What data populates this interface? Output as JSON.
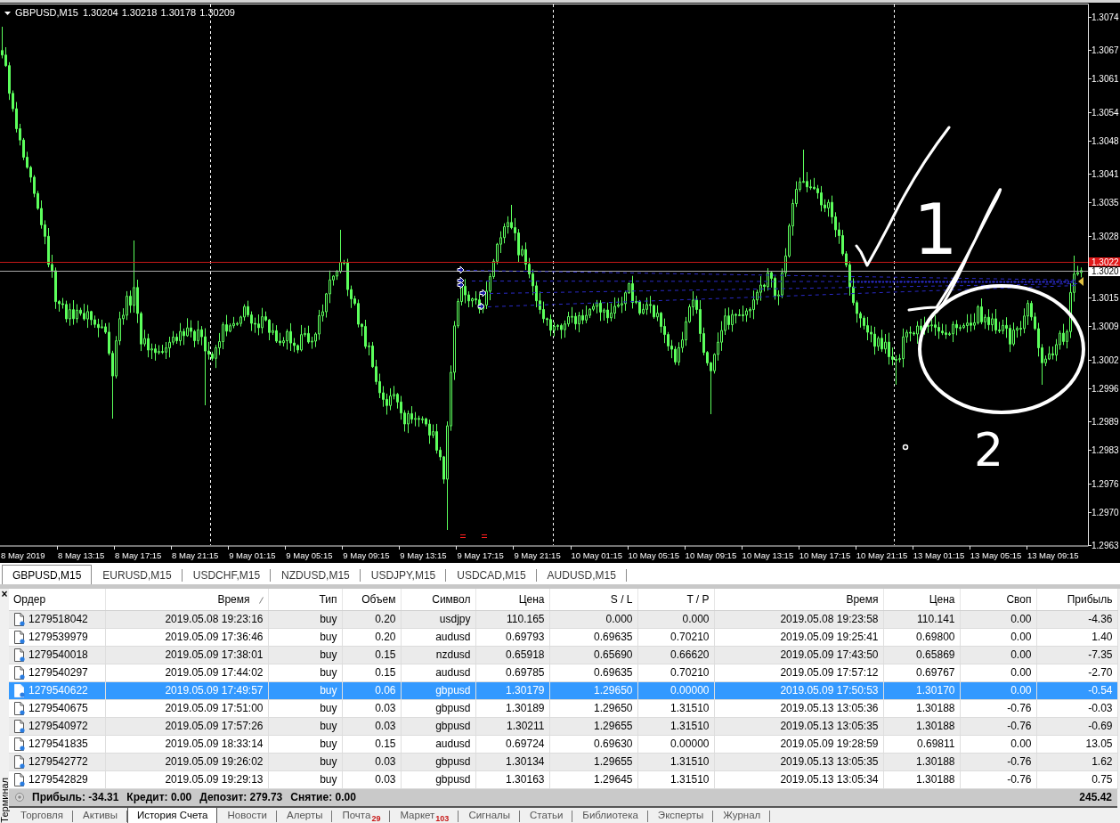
{
  "chart": {
    "symbol": "GBPUSD,M15",
    "quotes": [
      "1.30204",
      "1.30218",
      "1.30178",
      "1.30209"
    ],
    "price_labels": [
      "1.3074",
      "1.3067",
      "1.3061",
      "1.3054",
      "1.3048",
      "1.3041",
      "1.3035",
      "1.3028",
      "1.3015",
      "1.3009",
      "1.3002",
      "1.2996",
      "1.2989",
      "1.2983",
      "1.2976",
      "1.2970",
      "1.2963"
    ],
    "ask_label": "1.3022",
    "bid_label": "1.3020",
    "time_labels": [
      "8 May 2019",
      "8 May 13:15",
      "8 May 17:15",
      "8 May 21:15",
      "9 May 01:15",
      "9 May 05:15",
      "9 May 09:15",
      "9 May 13:15",
      "9 May 17:15",
      "9 May 21:15",
      "10 May 01:15",
      "10 May 05:15",
      "10 May 09:15",
      "10 May 13:15",
      "10 May 17:15",
      "10 May 21:15",
      "13 May 01:15",
      "13 May 05:15",
      "13 May 09:15"
    ],
    "annotations": [
      "1",
      "2"
    ]
  },
  "chart_tabs": [
    {
      "label": "GBPUSD,M15",
      "selected": true
    },
    {
      "label": "EURUSD,M15",
      "selected": false
    },
    {
      "label": "USDCHF,M15",
      "selected": false
    },
    {
      "label": "NZDUSD,M15",
      "selected": false
    },
    {
      "label": "USDJPY,M15",
      "selected": false
    },
    {
      "label": "USDCAD,M15",
      "selected": false
    },
    {
      "label": "AUDUSD,M15",
      "selected": false
    }
  ],
  "terminal": {
    "close_label": "×",
    "title": "Терминал",
    "columns": [
      {
        "label": "Ордер",
        "sorted": false
      },
      {
        "label": "Время",
        "sorted": true
      },
      {
        "label": "Тип",
        "sorted": false
      },
      {
        "label": "Объем",
        "sorted": false
      },
      {
        "label": "Символ",
        "sorted": false
      },
      {
        "label": "Цена",
        "sorted": false
      },
      {
        "label": "S / L",
        "sorted": false
      },
      {
        "label": "T / P",
        "sorted": false
      },
      {
        "label": "Время",
        "sorted": false
      },
      {
        "label": "Цена",
        "sorted": false
      },
      {
        "label": "Своп",
        "sorted": false
      },
      {
        "label": "Прибыль",
        "sorted": false
      }
    ],
    "rows": [
      {
        "selected": false,
        "cells": [
          "1279518042",
          "2019.05.08 19:23:16",
          "buy",
          "0.20",
          "usdjpy",
          "110.165",
          "0.000",
          "0.000",
          "2019.05.08 19:23:58",
          "110.141",
          "0.00",
          "-4.36"
        ]
      },
      {
        "selected": false,
        "cells": [
          "1279539979",
          "2019.05.09 17:36:46",
          "buy",
          "0.20",
          "audusd",
          "0.69793",
          "0.69635",
          "0.70210",
          "2019.05.09 19:25:41",
          "0.69800",
          "0.00",
          "1.40"
        ]
      },
      {
        "selected": false,
        "cells": [
          "1279540018",
          "2019.05.09 17:38:01",
          "buy",
          "0.15",
          "nzdusd",
          "0.65918",
          "0.65690",
          "0.66620",
          "2019.05.09 17:43:50",
          "0.65869",
          "0.00",
          "-7.35"
        ]
      },
      {
        "selected": false,
        "cells": [
          "1279540297",
          "2019.05.09 17:44:02",
          "buy",
          "0.15",
          "audusd",
          "0.69785",
          "0.69635",
          "0.70210",
          "2019.05.09 17:57:12",
          "0.69767",
          "0.00",
          "-2.70"
        ]
      },
      {
        "selected": true,
        "cells": [
          "1279540622",
          "2019.05.09 17:49:57",
          "buy",
          "0.06",
          "gbpusd",
          "1.30179",
          "1.29650",
          "0.00000",
          "2019.05.09 17:50:53",
          "1.30170",
          "0.00",
          "-0.54"
        ]
      },
      {
        "selected": false,
        "cells": [
          "1279540675",
          "2019.05.09 17:51:00",
          "buy",
          "0.03",
          "gbpusd",
          "1.30189",
          "1.29650",
          "1.31510",
          "2019.05.13 13:05:36",
          "1.30188",
          "-0.76",
          "-0.03"
        ]
      },
      {
        "selected": false,
        "cells": [
          "1279540972",
          "2019.05.09 17:57:26",
          "buy",
          "0.03",
          "gbpusd",
          "1.30211",
          "1.29655",
          "1.31510",
          "2019.05.13 13:05:35",
          "1.30188",
          "-0.76",
          "-0.69"
        ]
      },
      {
        "selected": false,
        "cells": [
          "1279541835",
          "2019.05.09 18:33:14",
          "buy",
          "0.15",
          "audusd",
          "0.69724",
          "0.69630",
          "0.00000",
          "2019.05.09 19:28:59",
          "0.69811",
          "0.00",
          "13.05"
        ]
      },
      {
        "selected": false,
        "cells": [
          "1279542772",
          "2019.05.09 19:26:02",
          "buy",
          "0.03",
          "gbpusd",
          "1.30134",
          "1.29655",
          "1.31510",
          "2019.05.13 13:05:35",
          "1.30188",
          "-0.76",
          "1.62"
        ]
      },
      {
        "selected": false,
        "cells": [
          "1279542829",
          "2019.05.09 19:29:13",
          "buy",
          "0.03",
          "gbpusd",
          "1.30163",
          "1.29645",
          "1.31510",
          "2019.05.13 13:05:34",
          "1.30188",
          "-0.76",
          "0.75"
        ]
      }
    ],
    "summary": [
      "Прибыль: -34.31",
      "Кредит: 0.00",
      "Депозит: 279.73",
      "Снятие: 0.00"
    ],
    "total": "245.42",
    "tabs": [
      {
        "label": "Торговля",
        "selected": false
      },
      {
        "label": "Активы",
        "selected": false
      },
      {
        "label": "История Счета",
        "selected": true
      },
      {
        "label": "Новости",
        "selected": false
      },
      {
        "label": "Алерты",
        "selected": false
      },
      {
        "label": "Почта",
        "badge": "29",
        "selected": false
      },
      {
        "label": "Маркет",
        "badge": "103",
        "selected": false
      },
      {
        "label": "Сигналы",
        "selected": false
      },
      {
        "label": "Статьи",
        "selected": false
      },
      {
        "label": "Библиотека",
        "selected": false
      },
      {
        "label": "Эксперты",
        "selected": false
      },
      {
        "label": "Журнал",
        "selected": false
      }
    ]
  }
}
